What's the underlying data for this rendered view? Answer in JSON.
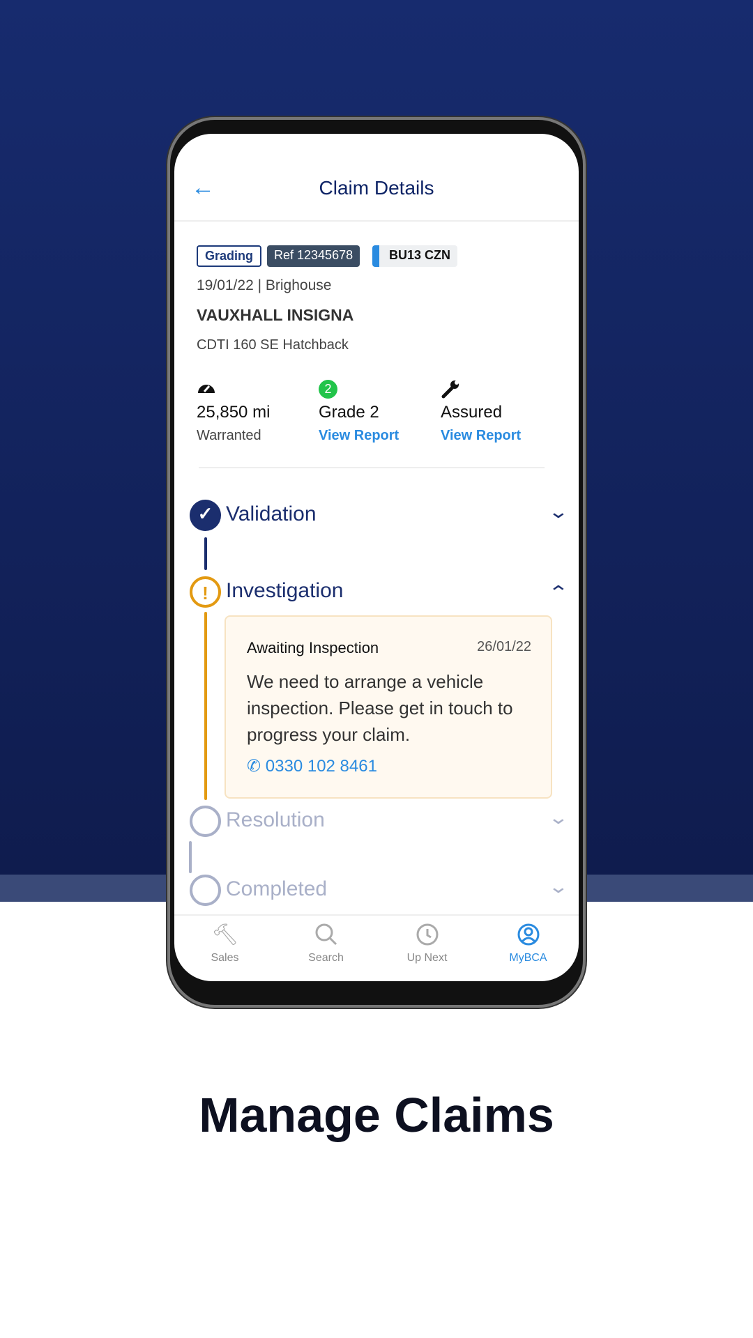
{
  "header": {
    "title": "Claim Details",
    "back_icon": "arrow-left-icon"
  },
  "chips": {
    "status": "Grading",
    "ref": "Ref 12345678",
    "plate": "BU13 CZN"
  },
  "vehicle": {
    "date_location": "19/01/22 | Brighouse",
    "make_model": "VAUXHALL INSIGNA",
    "variant": "CDTI 160  SE Hatchback"
  },
  "stats": [
    {
      "icon": "speedometer-icon",
      "value": "25,850 mi",
      "sub": "Warranted"
    },
    {
      "badge": "2",
      "value": "Grade 2",
      "link": "View Report"
    },
    {
      "icon": "wrench-icon",
      "value": "Assured",
      "link": "View Report"
    }
  ],
  "steps": [
    {
      "label": "Validation",
      "state": "complete",
      "color": "#1b2e6e"
    },
    {
      "label": "Investigation",
      "state": "active",
      "color": "#e39a12"
    },
    {
      "label": "Resolution",
      "state": "pending",
      "color": "#a9b0c8"
    },
    {
      "label": "Completed",
      "state": "pending",
      "color": "#a9b0c8"
    }
  ],
  "card": {
    "title": "Awaiting Inspection",
    "date": "26/01/22",
    "body": "We need to arrange a vehicle inspection. Please get in touch to progress your claim.",
    "phone": "0330 102 8461"
  },
  "nav": [
    {
      "label": "Sales",
      "icon": "gavel-icon"
    },
    {
      "label": "Search",
      "icon": "search-icon"
    },
    {
      "label": "Up Next",
      "icon": "clock-icon"
    },
    {
      "label": "MyBCA",
      "icon": "user-circle-icon",
      "active": true
    }
  ],
  "headline": "Manage Claims",
  "colors": {
    "accent": "#2a8be0",
    "navy": "#1b2e6e",
    "warning": "#e39a12"
  }
}
